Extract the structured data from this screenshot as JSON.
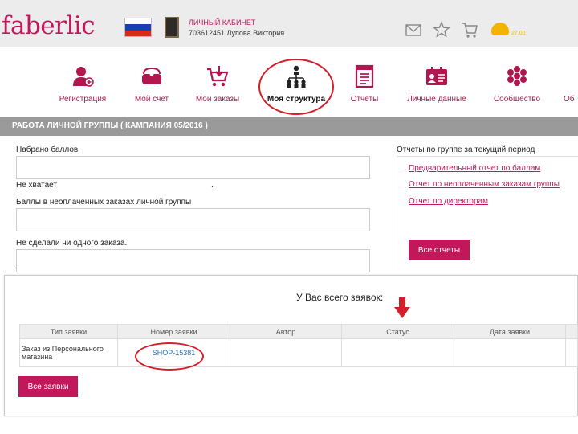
{
  "header": {
    "logo": "faberlic",
    "account_title": "ЛИЧНЫЙ КАБИНЕТ",
    "account_user": "703612451 Лупова Виктория",
    "coins_value": "27.00",
    "flag_colors": [
      "#ffffff",
      "#1a3fb0",
      "#d52b1e"
    ],
    "icons": [
      "mail-icon",
      "star-icon",
      "cart-icon",
      "coins-icon"
    ]
  },
  "nav": {
    "items": [
      {
        "label": "Регистрация",
        "icon": "add-user-icon"
      },
      {
        "label": "Мой счет",
        "icon": "wallet-icon"
      },
      {
        "label": "Мои заказы",
        "icon": "cart-download-icon"
      },
      {
        "label": "Моя структура",
        "icon": "structure-icon",
        "active": true
      },
      {
        "label": "Отчеты",
        "icon": "report-icon"
      },
      {
        "label": "Личные данные",
        "icon": "id-card-icon"
      },
      {
        "label": "Сообщество",
        "icon": "community-icon"
      },
      {
        "label": "Об"
      }
    ]
  },
  "section": {
    "title": "РАБОТА ЛИЧНОЙ ГРУППЫ ( КАМПАНИЯ 05/2016 )"
  },
  "form": {
    "collected_label": "Набрано баллов",
    "missing_label": "Не хватает",
    "missing_suffix": ".",
    "unpaid_label": "Баллы в неоплаченных заказах личной группы",
    "no_orders_label": "Не сделали ни одного заказа.",
    "dot": "."
  },
  "reports": {
    "title": "Отчеты по группе за текущий период",
    "links": [
      "Предварительный отчет по баллам",
      "Отчет по неоплаченным заказам группы",
      "Отчет по директорам"
    ],
    "all_button": "Все отчеты"
  },
  "orders_panel": {
    "title": "У Вас всего заявок:",
    "columns": [
      "Тип заявки",
      "Номер заявки",
      "Автор",
      "Статус",
      "Дата заявки"
    ],
    "rows": [
      {
        "type": "Заказ из Персонального магазина",
        "number": "SHOP-15381",
        "author": "",
        "status": "",
        "date": ""
      }
    ],
    "all_button": "Все заявки"
  },
  "accent_colors": {
    "brand": "#c2185b",
    "annotation": "#d21f2a",
    "link": "#1f6fb5"
  }
}
